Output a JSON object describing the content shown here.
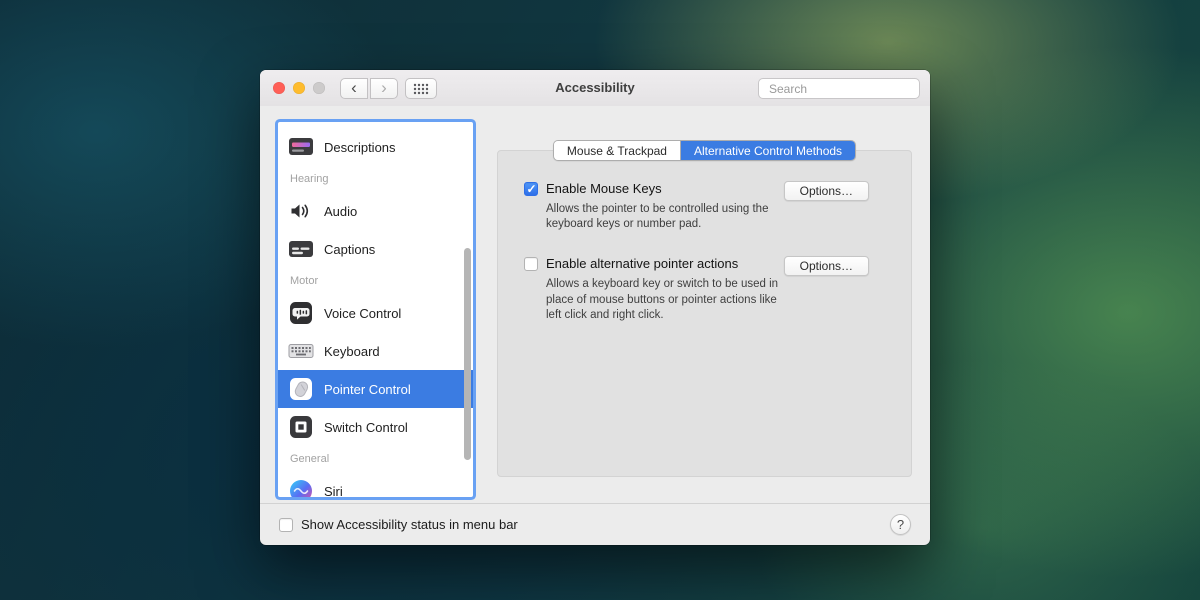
{
  "window": {
    "title": "Accessibility",
    "toolbar": {
      "back_icon": "‹",
      "forward_icon": "›",
      "search_placeholder": "Search"
    }
  },
  "sidebar": {
    "items": [
      {
        "type": "item",
        "label": "Descriptions",
        "icon": "descriptions-icon"
      },
      {
        "type": "header",
        "label": "Hearing"
      },
      {
        "type": "item",
        "label": "Audio",
        "icon": "audio-speaker-icon"
      },
      {
        "type": "item",
        "label": "Captions",
        "icon": "captions-icon"
      },
      {
        "type": "header",
        "label": "Motor"
      },
      {
        "type": "item",
        "label": "Voice Control",
        "icon": "voice-control-icon"
      },
      {
        "type": "item",
        "label": "Keyboard",
        "icon": "keyboard-icon"
      },
      {
        "type": "item",
        "label": "Pointer Control",
        "icon": "pointer-control-icon",
        "selected": true
      },
      {
        "type": "item",
        "label": "Switch Control",
        "icon": "switch-control-icon"
      },
      {
        "type": "header",
        "label": "General"
      },
      {
        "type": "item",
        "label": "Siri",
        "icon": "siri-icon"
      }
    ]
  },
  "main": {
    "tabs": [
      {
        "label": "Mouse & Trackpad",
        "selected": false
      },
      {
        "label": "Alternative Control Methods",
        "selected": true
      }
    ],
    "rows": [
      {
        "label": "Enable Mouse Keys",
        "checked": true,
        "button_label": "Options…",
        "description": "Allows the pointer to be controlled using the keyboard keys or number pad."
      },
      {
        "label": "Enable alternative pointer actions",
        "checked": false,
        "button_label": "Options…",
        "description": "Allows a keyboard key or switch to be used in place of mouse buttons or pointer actions like left click and right click."
      }
    ]
  },
  "footer": {
    "checkbox_label": "Show Accessibility status in menu bar",
    "checkbox_checked": false,
    "help_label": "?"
  },
  "colors": {
    "accent_blue": "#3b7ce2",
    "traffic_red": "#ff5f57",
    "traffic_yellow": "#febc2e",
    "traffic_gray": "#cdcbcb"
  }
}
